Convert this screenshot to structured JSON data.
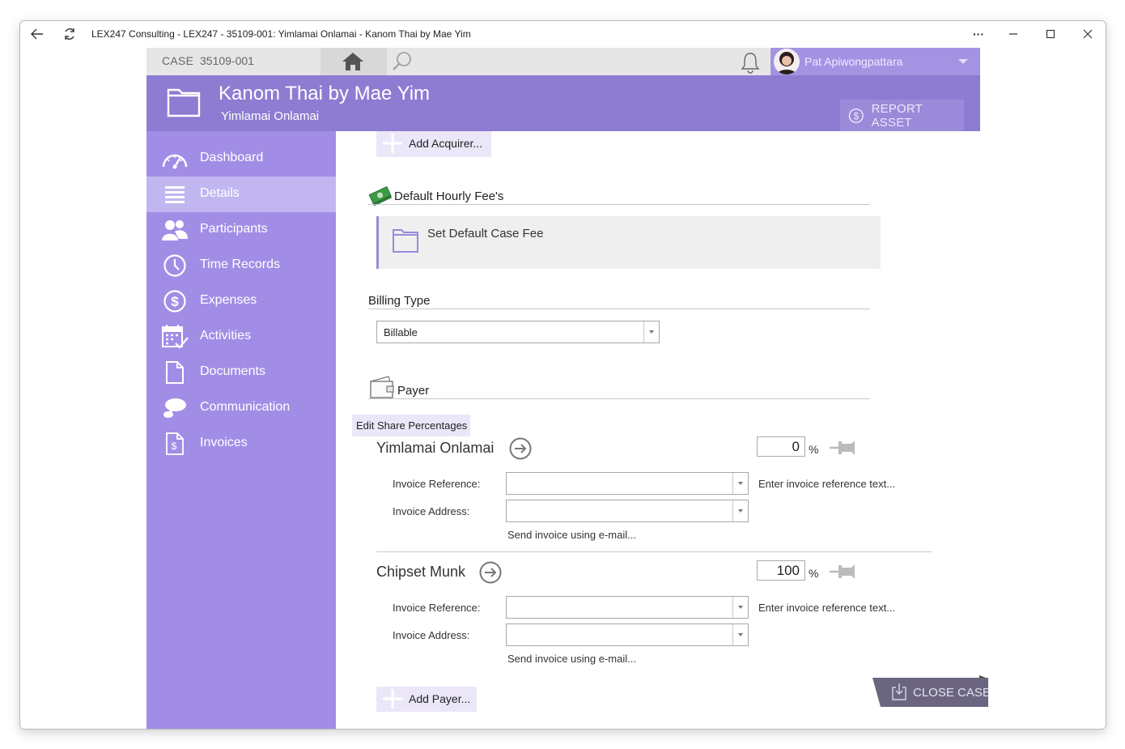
{
  "window": {
    "title": "LEX247 Consulting - LEX247 - 35109-001: Yimlamai Onlamai - Kanom Thai by Mae Yim",
    "more_label": "···"
  },
  "topbar": {
    "case_label": "CASE",
    "case_number": "35109-001",
    "user_name": "Pat Apiwongpattara"
  },
  "header": {
    "title": "Kanom Thai by Mae Yim",
    "subtitle": "Yimlamai Onlamai",
    "report_button": "REPORT ASSET"
  },
  "sidebar": {
    "items": [
      {
        "label": "Dashboard",
        "icon": "gauge-icon"
      },
      {
        "label": "Details",
        "icon": "list-icon",
        "active": true
      },
      {
        "label": "Participants",
        "icon": "people-icon"
      },
      {
        "label": "Time Records",
        "icon": "clock-icon"
      },
      {
        "label": "Expenses",
        "icon": "dollar-circle-icon"
      },
      {
        "label": "Activities",
        "icon": "calendar-check-icon"
      },
      {
        "label": "Documents",
        "icon": "document-icon"
      },
      {
        "label": "Communication",
        "icon": "chat-icon"
      },
      {
        "label": "Invoices",
        "icon": "invoice-icon"
      }
    ]
  },
  "main": {
    "add_acquirer": "Add Acquirer...",
    "fees_title": "Default Hourly Fee's",
    "set_fee_label": "Set Default Case Fee",
    "billing_title": "Billing Type",
    "billing_value": "Billable",
    "payer_title": "Payer",
    "edit_share": "Edit Share Percentages",
    "payers": [
      {
        "name": "Yimlamai Onlamai",
        "percent": "0",
        "percent_sign": "%",
        "invoice_reference_label": "Invoice Reference:",
        "invoice_address_label": "Invoice Address:",
        "reference_hint": "Enter invoice reference text...",
        "email_hint": "Send invoice using e-mail..."
      },
      {
        "name": "Chipset Munk",
        "percent": "100",
        "percent_sign": "%",
        "invoice_reference_label": "Invoice Reference:",
        "invoice_address_label": "Invoice Address:",
        "reference_hint": "Enter invoice reference text...",
        "email_hint": "Send invoice using e-mail..."
      }
    ],
    "add_payer": "Add Payer...",
    "close_case": "CLOSE CASE"
  },
  "colors": {
    "header": "#8d7cd2",
    "sidebar": "#a28de6",
    "sidebar_active": "#c2b6f1",
    "accent_button": "#ebe7f8",
    "close_case_bg": "#6b6580"
  }
}
